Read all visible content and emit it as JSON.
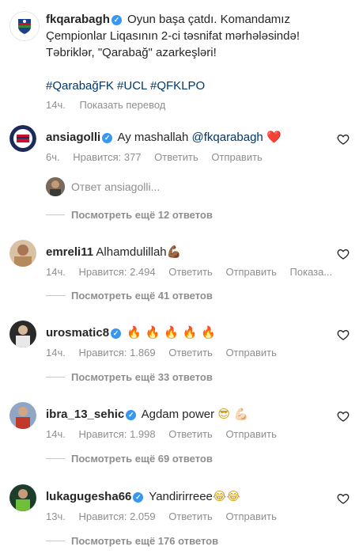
{
  "caption": {
    "username": "fkqarabagh",
    "text_line1": "Oyun başa çatdı. Komandamız",
    "text_line2": "Çempionlar Liqasının 2-ci təsnifat mərhələsində!",
    "text_line3": "Təbriklər, \"Qarabağ\" azarkeşləri!",
    "hashtags": "#QarabağFK #UCL #QFKLPO",
    "time": "14ч.",
    "translate": "Показать перевод"
  },
  "comments": [
    {
      "username": "ansiagolli",
      "verified": true,
      "text": "Ay mashallah",
      "mention": "@fkqarabagh",
      "emoji": "❤️",
      "time": "6ч.",
      "likes": "Нравится: 377",
      "reply": "Ответить",
      "send": "Отправить",
      "extra": ""
    },
    {
      "username": "emreli11",
      "verified": false,
      "text": "Alhamdulillah",
      "mention": "",
      "emoji": "💪🏾",
      "time": "14ч.",
      "likes": "Нравится: 2.494",
      "reply": "Ответить",
      "send": "Отправить",
      "extra": "Показа..."
    },
    {
      "username": "urosmatic8",
      "verified": true,
      "text": "",
      "mention": "",
      "emoji": "🔥 🔥 🔥 🔥 🔥",
      "time": "14ч.",
      "likes": "Нравится: 1.869",
      "reply": "Ответить",
      "send": "Отправить",
      "extra": ""
    },
    {
      "username": "ibra_13_sehic",
      "verified": true,
      "text": "Agdam power",
      "mention": "",
      "emoji": "😎 💪🏻",
      "time": "14ч.",
      "likes": "Нравится: 1.998",
      "reply": "Ответить",
      "send": "Отправить",
      "extra": ""
    },
    {
      "username": "lukagugesha66",
      "verified": true,
      "text": "Yandirirreee",
      "mention": "",
      "emoji": "😂😂",
      "time": "13ч.",
      "likes": "Нравится: 2.059",
      "reply": "Ответить",
      "send": "Отправить",
      "extra": ""
    }
  ],
  "reply_prompt": "Ответ ansiagolli...",
  "view_more": [
    "Посмотреть ещё 12 ответов",
    "Посмотреть ещё 41 ответов",
    "Посмотреть ещё 33 ответов",
    "Посмотреть ещё 69 ответов",
    "Посмотреть ещё 176 ответов"
  ],
  "colors": {
    "link": "#00376b",
    "verified": "#3897f0",
    "muted": "#8e8e8e"
  }
}
